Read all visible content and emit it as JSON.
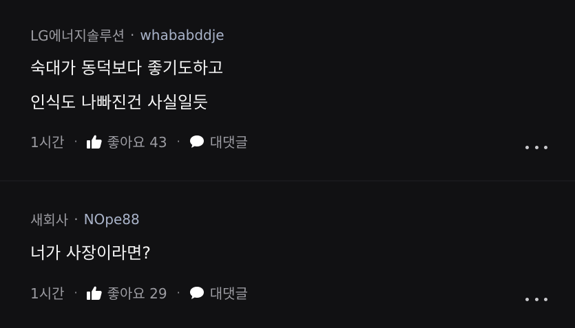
{
  "comments": [
    {
      "company": "LG에너지솔루션",
      "separator": "·",
      "author": "whababddje",
      "lines": [
        "숙대가 동덕보다 좋기도하고",
        "인식도 나빠진건 사실일듯"
      ],
      "time": "1시간",
      "bullet": "·",
      "like_label": "좋아요 43",
      "reply_label": "대댓글"
    },
    {
      "company": "새회사",
      "separator": "·",
      "author": "NOpe88",
      "lines": [
        "너가 사장이라면?"
      ],
      "time": "1시간",
      "bullet": "·",
      "like_label": "좋아요 29",
      "reply_label": "대댓글"
    }
  ],
  "icons": {
    "like": "thumbs-up-icon",
    "reply": "speech-bubble-icon",
    "more": "more-horizontal-icon"
  },
  "colors": {
    "background": "#111113",
    "body_text": "#f4f4f4",
    "meta_text": "#9b9ba1",
    "author_text": "#a9b3c9"
  }
}
